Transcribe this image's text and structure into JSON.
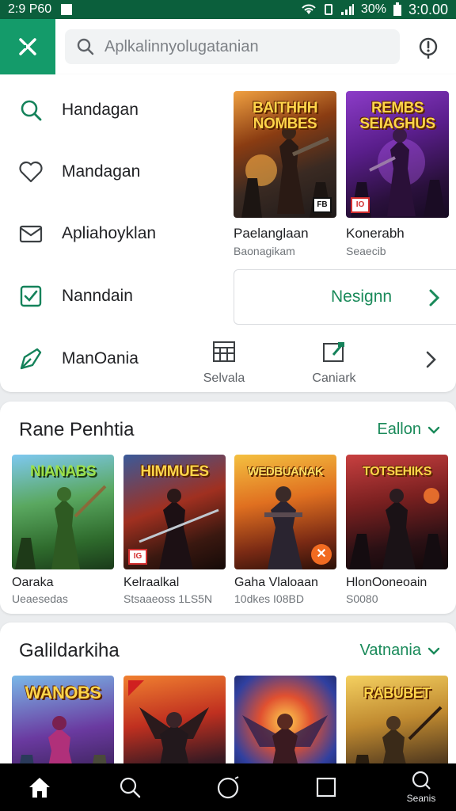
{
  "status_bar": {
    "time_left": "2:9 P60",
    "battery": "30%",
    "time_right": "3:0.00"
  },
  "search": {
    "placeholder": "Aplkalinnyolugatanian"
  },
  "icons": {
    "menu": "close-x-icon",
    "search": "search-icon",
    "alert": "alert-pin-icon",
    "nav": [
      "search-icon",
      "heart-icon",
      "mail-icon",
      "checkbox-icon",
      "tag-icon"
    ],
    "quick": [
      "grid-calendar-icon",
      "edit-card-icon"
    ],
    "bottom": [
      "home-icon",
      "search-icon",
      "circle-home-icon",
      "square-recents-icon",
      "search-icon"
    ]
  },
  "nav_menu": {
    "items": [
      {
        "label": "Handagan"
      },
      {
        "label": "Mandagan"
      },
      {
        "label": "Apliahoyklan"
      },
      {
        "label": "Nanndain"
      },
      {
        "label": "ManOania"
      }
    ]
  },
  "featured": [
    {
      "art_title": "BAITHHH NOMBES",
      "name": "Paelanglaan",
      "sub": "Baonagikam",
      "badge": "FB"
    },
    {
      "art_title": "REMBS SEIAGHUS",
      "name": "Konerabh",
      "sub": "Seaecib",
      "badge": "IO"
    }
  ],
  "promo": {
    "label": "Nesignn"
  },
  "quick_actions": [
    {
      "label": "Selvala"
    },
    {
      "label": "Caniark"
    }
  ],
  "section1": {
    "title": "Rane Penhtia",
    "more": "Eallon",
    "games": [
      {
        "art_title": "NIANABS",
        "name": "Oaraka",
        "sub": "Ueaesedas"
      },
      {
        "art_title": "HIMMUES",
        "name": "Kelraalkal",
        "sub": "Stsaaeoss 1LS5N",
        "badge": "IG"
      },
      {
        "art_title": "WEDBUANAK",
        "name": "Gaha Vlaloaan",
        "sub": "10dkes I08BD",
        "badge_symbol": "✕"
      },
      {
        "art_title": "TOTSEHIKS",
        "name": "HlonOoneoain",
        "sub": "S0080"
      }
    ]
  },
  "section2": {
    "title": "Galildarkiha",
    "more": "Vatnania",
    "games": [
      {
        "art_title": "WANOBS"
      },
      {
        "art_title": ""
      },
      {
        "art_title": ""
      },
      {
        "art_title": "RABUBET"
      }
    ]
  },
  "bottom_nav": {
    "last_label": "Seanis"
  },
  "colors": {
    "status_bar": "#0b5f3c",
    "accent": "#149b6a",
    "accent_text": "#1a8a5a"
  }
}
